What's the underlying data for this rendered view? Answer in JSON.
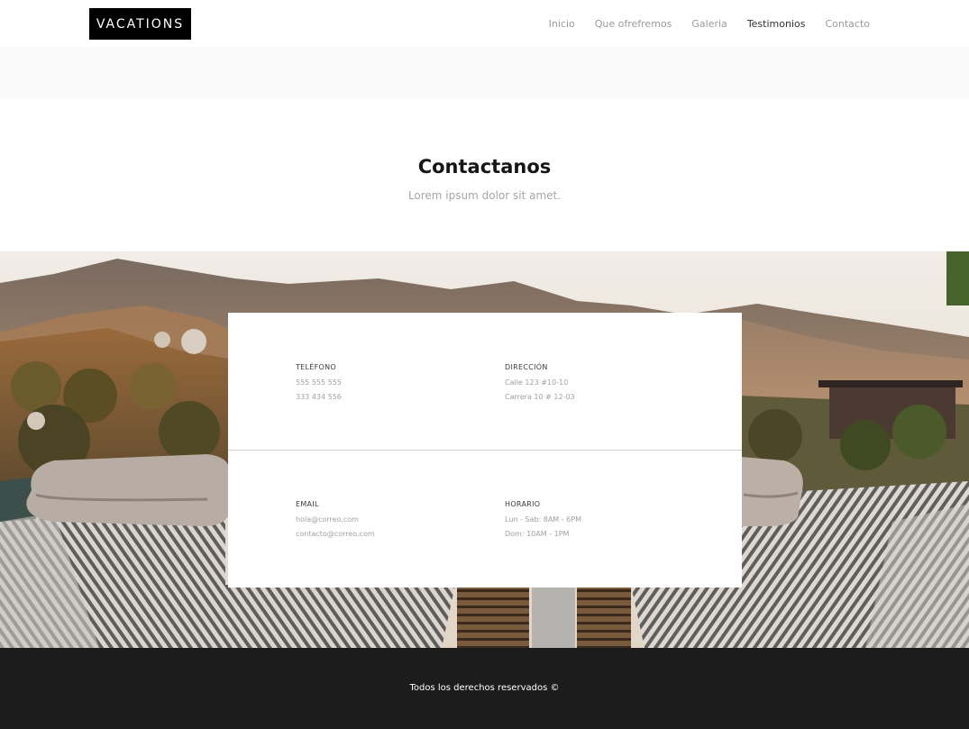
{
  "brand": {
    "logo": "VACATIONS"
  },
  "nav": {
    "items": [
      {
        "label": "Inicio"
      },
      {
        "label": "Que ofrefremos"
      },
      {
        "label": "Galeria"
      },
      {
        "label": "Testimonios"
      },
      {
        "label": "Contacto"
      }
    ],
    "active_index": 3
  },
  "contact": {
    "title": "Contactanos",
    "subtitle": "Lorem ipsum dolor sit amet.",
    "telefono": {
      "label": "TELÉFONO",
      "lines": [
        "555 555 555",
        "333 434 556"
      ]
    },
    "direccion": {
      "label": "DIRECCIÓN",
      "lines": [
        "Calle 123 #10-10",
        "Carrera 10 # 12-03"
      ]
    },
    "email": {
      "label": "EMAIL",
      "lines": [
        "hola@correo.com",
        "contacto@correo.com"
      ]
    },
    "horario": {
      "label": "HORARIO",
      "lines": [
        "Lun - Sab: 8AM - 6PM",
        "Dom: 10AM - 1PM"
      ]
    }
  },
  "footer": {
    "text": "Todos los derechos reservados ©"
  },
  "colors": {
    "logo_bg": "#000000",
    "footer_bg": "#1c1c1c",
    "band_bg": "#f9f9f9",
    "nav_text": "#9a9a9a",
    "nav_active": "#333333"
  }
}
